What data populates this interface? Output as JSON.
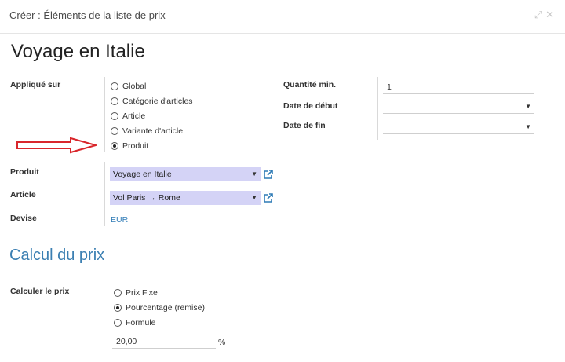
{
  "dialog": {
    "title": "Créer : Éléments de la liste de prix",
    "expand_icon": "⤢",
    "close_icon": "✕"
  },
  "record": {
    "name": "Voyage en Italie"
  },
  "applied_on": {
    "label": "Appliqué sur",
    "options": [
      "Global",
      "Catégorie d'articles",
      "Article",
      "Variante d'article",
      "Produit"
    ],
    "selected": "Produit"
  },
  "right_fields": {
    "min_qty": {
      "label": "Quantité min.",
      "value": "1"
    },
    "date_start": {
      "label": "Date de début",
      "value": ""
    },
    "date_end": {
      "label": "Date de fin",
      "value": ""
    }
  },
  "product": {
    "label": "Produit",
    "value": "Voyage en Italie"
  },
  "article": {
    "label": "Article",
    "value": "Vol Paris → Rome"
  },
  "currency": {
    "label": "Devise",
    "value": "EUR"
  },
  "price_section": {
    "title": "Calcul du prix",
    "compute_label": "Calculer le prix",
    "options": [
      "Prix Fixe",
      "Pourcentage (remise)",
      "Formule"
    ],
    "selected": "Pourcentage (remise)",
    "percent_value": "20,00",
    "percent_unit": "%"
  },
  "colors": {
    "select_bg": "#d4d3f6",
    "link": "#2f7bb6",
    "section_title": "#3b7fb2",
    "annotation_arrow": "#d9262b"
  },
  "icons": {
    "external_link": "external-link-icon",
    "annotation": "red-arrow-icon"
  }
}
